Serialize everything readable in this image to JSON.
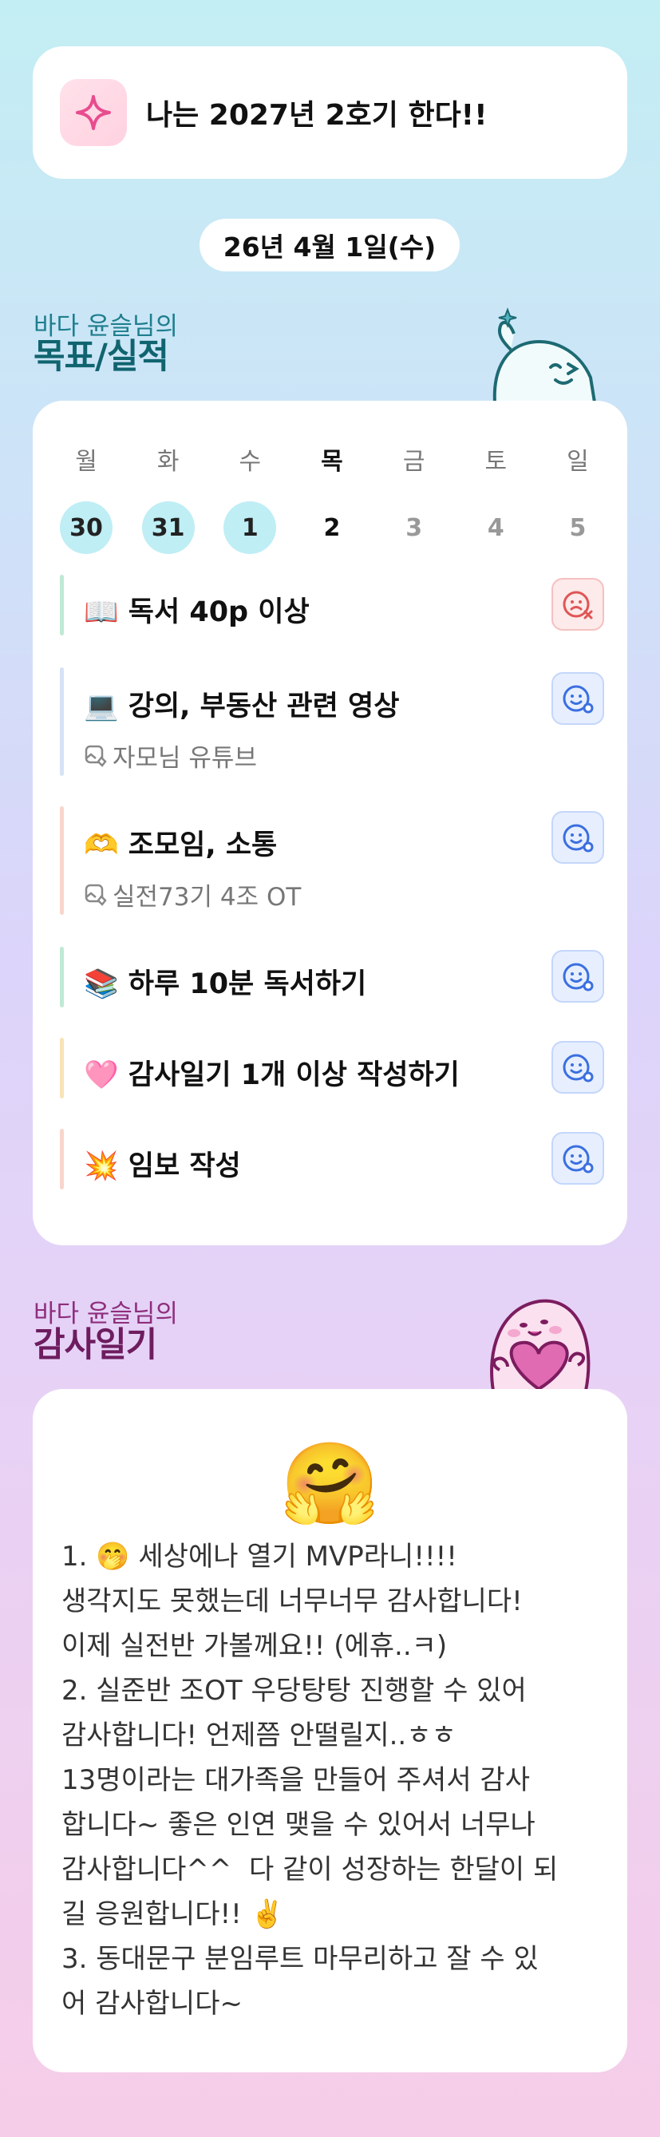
{
  "goal": {
    "text": "나는 2027년 2호기 한다!!"
  },
  "date": "26년 4월 1일(수)",
  "goals_section": {
    "owner": "바다 윤슬님의",
    "title": "목표/실적"
  },
  "week": [
    {
      "name": "월",
      "num": "30",
      "state": "done"
    },
    {
      "name": "화",
      "num": "31",
      "state": "done"
    },
    {
      "name": "수",
      "num": "1",
      "state": "done"
    },
    {
      "name": "목",
      "num": "2",
      "state": "today"
    },
    {
      "name": "금",
      "num": "3",
      "state": "future"
    },
    {
      "name": "토",
      "num": "4",
      "state": "future"
    },
    {
      "name": "일",
      "num": "5",
      "state": "future"
    }
  ],
  "tasks": [
    {
      "title": "📖 독서 40p 이상",
      "sub": "",
      "status": "fail",
      "bar_color": "#bfe9d6"
    },
    {
      "title": "💻 강의, 부동산 관련 영상",
      "sub": "자모님 유튜브",
      "status": "done",
      "bar_color": "#d6e3f5"
    },
    {
      "title": "🫶 조모임, 소통",
      "sub": "실전73기 4조 OT",
      "status": "done",
      "bar_color": "#f7d6cc"
    },
    {
      "title": "📚 하루 10분 독서하기",
      "sub": "",
      "status": "done",
      "bar_color": "#bfe9d6"
    },
    {
      "title": "🩷 감사일기 1개 이상 작성하기",
      "sub": "",
      "status": "done",
      "bar_color": "#f8e3b8"
    },
    {
      "title": "💥 임보 작성",
      "sub": "",
      "status": "done",
      "bar_color": "#f7d6cc"
    }
  ],
  "diary_section": {
    "owner": "바다 윤슬님의",
    "title": "감사일기"
  },
  "diary": {
    "emoji": "🤗",
    "text": "1. 🤭 세상에나 열기 MVP라니!!!!\n생각지도 못했는데 너무너무 감사합니다!\n이제 실전반 가볼께요!! (에휴..ㅋ)\n2. 실준반 조OT 우당탕탕 진행할 수 있어\n감사합니다! 언제쯤 안떨릴지..ㅎㅎ\n13명이라는 대가족을 만들어 주셔서 감사\n합니다~ 좋은 인연 맺을 수 있어서 너무나\n감사합니다^^  다 같이 성장하는 한달이 되\n길 응원합니다!! ✌️\n3. 동대문구 분임루트 마무리하고 잘 수 있\n어 감사합니다~"
  },
  "colors": {
    "goals_title": "#10646f",
    "diary_title": "#6e1c5f",
    "done_day": "#bfeef5",
    "status_done": "#3b6fe0",
    "status_fail": "#e05555"
  }
}
